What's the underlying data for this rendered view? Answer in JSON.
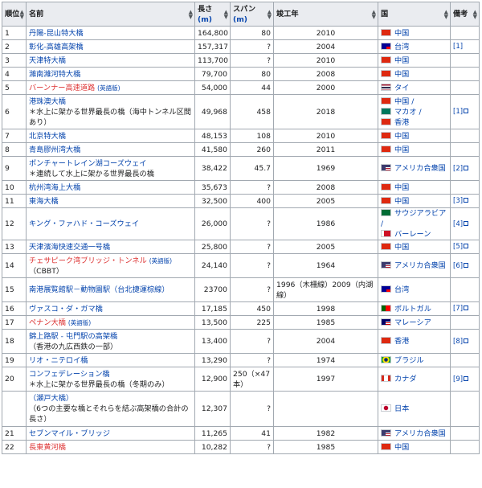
{
  "headers": {
    "rank": "順位",
    "name": "名前",
    "length": "長さ",
    "length_unit": "(m)",
    "span": "スパン",
    "span_unit": "(m)",
    "year": "竣工年",
    "country": "国",
    "notes": "備考"
  },
  "sort_up": "▲",
  "sort_down": "▼",
  "rows": [
    {
      "rank": "1",
      "name": "丹陽-昆山特大橋",
      "length": "164,800",
      "span": "80",
      "year": "2010",
      "countries": [
        {
          "name": "中国",
          "flag": "cn"
        }
      ]
    },
    {
      "rank": "2",
      "name": "彰化-高雄高架橋",
      "length": "157,317",
      "span": "?",
      "year": "2004",
      "countries": [
        {
          "name": "台湾",
          "flag": "tw"
        }
      ],
      "ref": "[1]"
    },
    {
      "rank": "3",
      "name": "天津特大橋",
      "length": "113,700",
      "span": "?",
      "year": "2010",
      "countries": [
        {
          "name": "中国",
          "flag": "cn"
        }
      ]
    },
    {
      "rank": "4",
      "name": "濰南濰河特大橋",
      "length": "79,700",
      "span": "80",
      "year": "2008",
      "countries": [
        {
          "name": "中国",
          "flag": "cn"
        }
      ]
    },
    {
      "rank": "5",
      "name": "バーンナー高速道路",
      "name_class": "red",
      "tag": "(英語版)",
      "length": "54,000",
      "span": "44",
      "year": "2000",
      "countries": [
        {
          "name": "タイ",
          "flag": "th"
        }
      ]
    },
    {
      "rank": "6",
      "name": "港珠澳大橋",
      "note": "＊水上に架かる世界最長の橋（海中トンネル区間あり）",
      "length": "49,968",
      "span": "458",
      "year": "2018",
      "countries": [
        {
          "name": "中国 /",
          "flag": "cn"
        },
        {
          "name": "マカオ /",
          "flag": "mo"
        },
        {
          "name": "香港",
          "flag": "hk"
        }
      ],
      "ref": "[1]",
      "ext": true
    },
    {
      "rank": "7",
      "name": "北京特大橋",
      "length": "48,153",
      "span": "108",
      "year": "2010",
      "countries": [
        {
          "name": "中国",
          "flag": "cn"
        }
      ]
    },
    {
      "rank": "8",
      "name": "青島膠州湾大橋",
      "length": "41,580",
      "span": "260",
      "year": "2011",
      "countries": [
        {
          "name": "中国",
          "flag": "cn"
        }
      ]
    },
    {
      "rank": "9",
      "name": "ポンチャートレイン湖コーズウェイ",
      "note": "＊連続して水上に架かる世界最長の橋",
      "length": "38,422",
      "span": "45.7",
      "year": "1969",
      "countries": [
        {
          "name": "アメリカ合衆国",
          "flag": "us"
        }
      ],
      "ref": "[2]",
      "ext": true
    },
    {
      "rank": "10",
      "name": "杭州湾海上大橋",
      "length": "35,673",
      "span": "?",
      "year": "2008",
      "countries": [
        {
          "name": "中国",
          "flag": "cn"
        }
      ]
    },
    {
      "rank": "11",
      "name": "東海大橋",
      "length": "32,500",
      "span": "400",
      "year": "2005",
      "countries": [
        {
          "name": "中国",
          "flag": "cn"
        }
      ],
      "ref": "[3]",
      "ext": true
    },
    {
      "rank": "12",
      "name": "キング・ファハド・コーズウェイ",
      "length": "26,000",
      "span": "?",
      "year": "1986",
      "countries": [
        {
          "name": "サウジアラビア",
          "flag": "sa"
        },
        {
          "name": "/",
          "flag": ""
        },
        {
          "name": "バーレーン",
          "flag": "bh"
        }
      ],
      "ref": "[4]",
      "ext": true
    },
    {
      "rank": "13",
      "name": "天津濱海快速交通一号橋",
      "length": "25,800",
      "span": "?",
      "year": "2005",
      "countries": [
        {
          "name": "中国",
          "flag": "cn"
        }
      ],
      "ref": "[5]",
      "ext": true
    },
    {
      "rank": "14",
      "name": "チェサピーク湾ブリッジ・トンネル",
      "name_class": "red",
      "tag": "(英語版)",
      "note": "（CBBT）",
      "length": "24,140",
      "span": "?",
      "year": "1964",
      "countries": [
        {
          "name": "アメリカ合衆国",
          "flag": "us"
        }
      ],
      "ref": "[6]",
      "ext": true
    },
    {
      "rank": "15",
      "name": "南港展覧館駅－動物園駅（台北捷運棕線）",
      "length": "23700",
      "span": "?",
      "year": "1996（木柵線）2009（内湖線）",
      "year_left": true,
      "countries": [
        {
          "name": "台湾",
          "flag": "tw"
        }
      ]
    },
    {
      "rank": "16",
      "name": "ヴァスコ・ダ・ガマ橋",
      "length": "17,185",
      "span": "450",
      "year": "1998",
      "countries": [
        {
          "name": "ポルトガル",
          "flag": "pt"
        }
      ],
      "ref": "[7]",
      "ext": true
    },
    {
      "rank": "17",
      "name": "ペナン大橋",
      "name_class": "red",
      "tag": "(英語版)",
      "length": "13,500",
      "span": "225",
      "year": "1985",
      "countries": [
        {
          "name": "マレーシア",
          "flag": "my"
        }
      ]
    },
    {
      "rank": "18",
      "name": "錦上路駅 - 屯門駅の高架橋",
      "note": "（香港の九広西鉄の一部）",
      "length": "13,400",
      "span": "?",
      "year": "2004",
      "countries": [
        {
          "name": "香港",
          "flag": "hk"
        }
      ],
      "ref": "[8]",
      "ext": true
    },
    {
      "rank": "19",
      "name": "リオ・ニテロイ橋",
      "length": "13,290",
      "span": "?",
      "year": "1974",
      "countries": [
        {
          "name": "ブラジル",
          "flag": "br"
        }
      ]
    },
    {
      "rank": "20",
      "name": "コンフェデレーション橋",
      "note": "＊水上に架かる世界最長の橋（冬期のみ）",
      "length": "12,900",
      "span": "250（×47本）",
      "span_left": true,
      "year": "1997",
      "countries": [
        {
          "name": "カナダ",
          "flag": "ca"
        }
      ],
      "ref": "[9]",
      "ext": true
    },
    {
      "rank": "",
      "name": "（瀬戸大橋）",
      "note": "（6つの主要な橋とそれらを結ぶ高架橋の合計の長さ）",
      "length": "12,307",
      "span": "?",
      "year": "",
      "countries": [
        {
          "name": "日本",
          "flag": "jp"
        }
      ]
    },
    {
      "rank": "21",
      "name": "セブンマイル・ブリッジ",
      "length": "11,265",
      "span": "41",
      "year": "1982",
      "countries": [
        {
          "name": "アメリカ合衆国",
          "flag": "us"
        }
      ]
    },
    {
      "rank": "22",
      "name": "長東黄河橋",
      "name_class": "red",
      "length": "10,282",
      "span": "?",
      "year": "1985",
      "countries": [
        {
          "name": "中国",
          "flag": "cn"
        }
      ]
    }
  ],
  "flag_colors": {
    "cn": "#de2910",
    "tw": "#fe0000",
    "th": "#2d2a4a",
    "mo": "#00785e",
    "hk": "#de2910",
    "us": "#b22234",
    "sa": "#006c35",
    "bh": "#ce1126",
    "pt": "#006600",
    "my": "#cc0001",
    "br": "#009c3b",
    "ca": "#d52b1e",
    "jp": "#ffffff"
  }
}
